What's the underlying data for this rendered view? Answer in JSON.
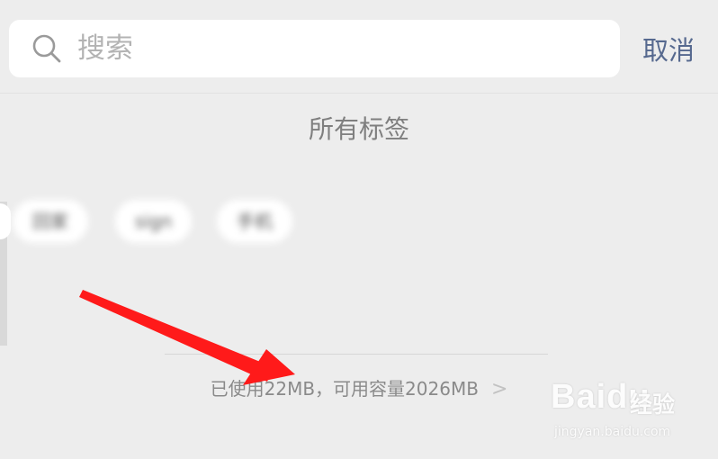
{
  "search": {
    "placeholder": "搜索",
    "cancel_label": "取消",
    "icon": "search-icon"
  },
  "tags_section": {
    "title": "所有标签",
    "tags": [
      "回家",
      "sign",
      "手机"
    ]
  },
  "storage": {
    "text": "已使用22MB，可用容量2026MB",
    "chevron": ">"
  },
  "annotation": {
    "arrow_color": "#ff1a1a"
  },
  "watermark": {
    "brand": "Baidu",
    "sub": "经验",
    "url": "jingyan.baidu.com"
  },
  "colors": {
    "background": "#ededed",
    "cancel": "#56698f",
    "placeholder": "#b3b3b3"
  }
}
